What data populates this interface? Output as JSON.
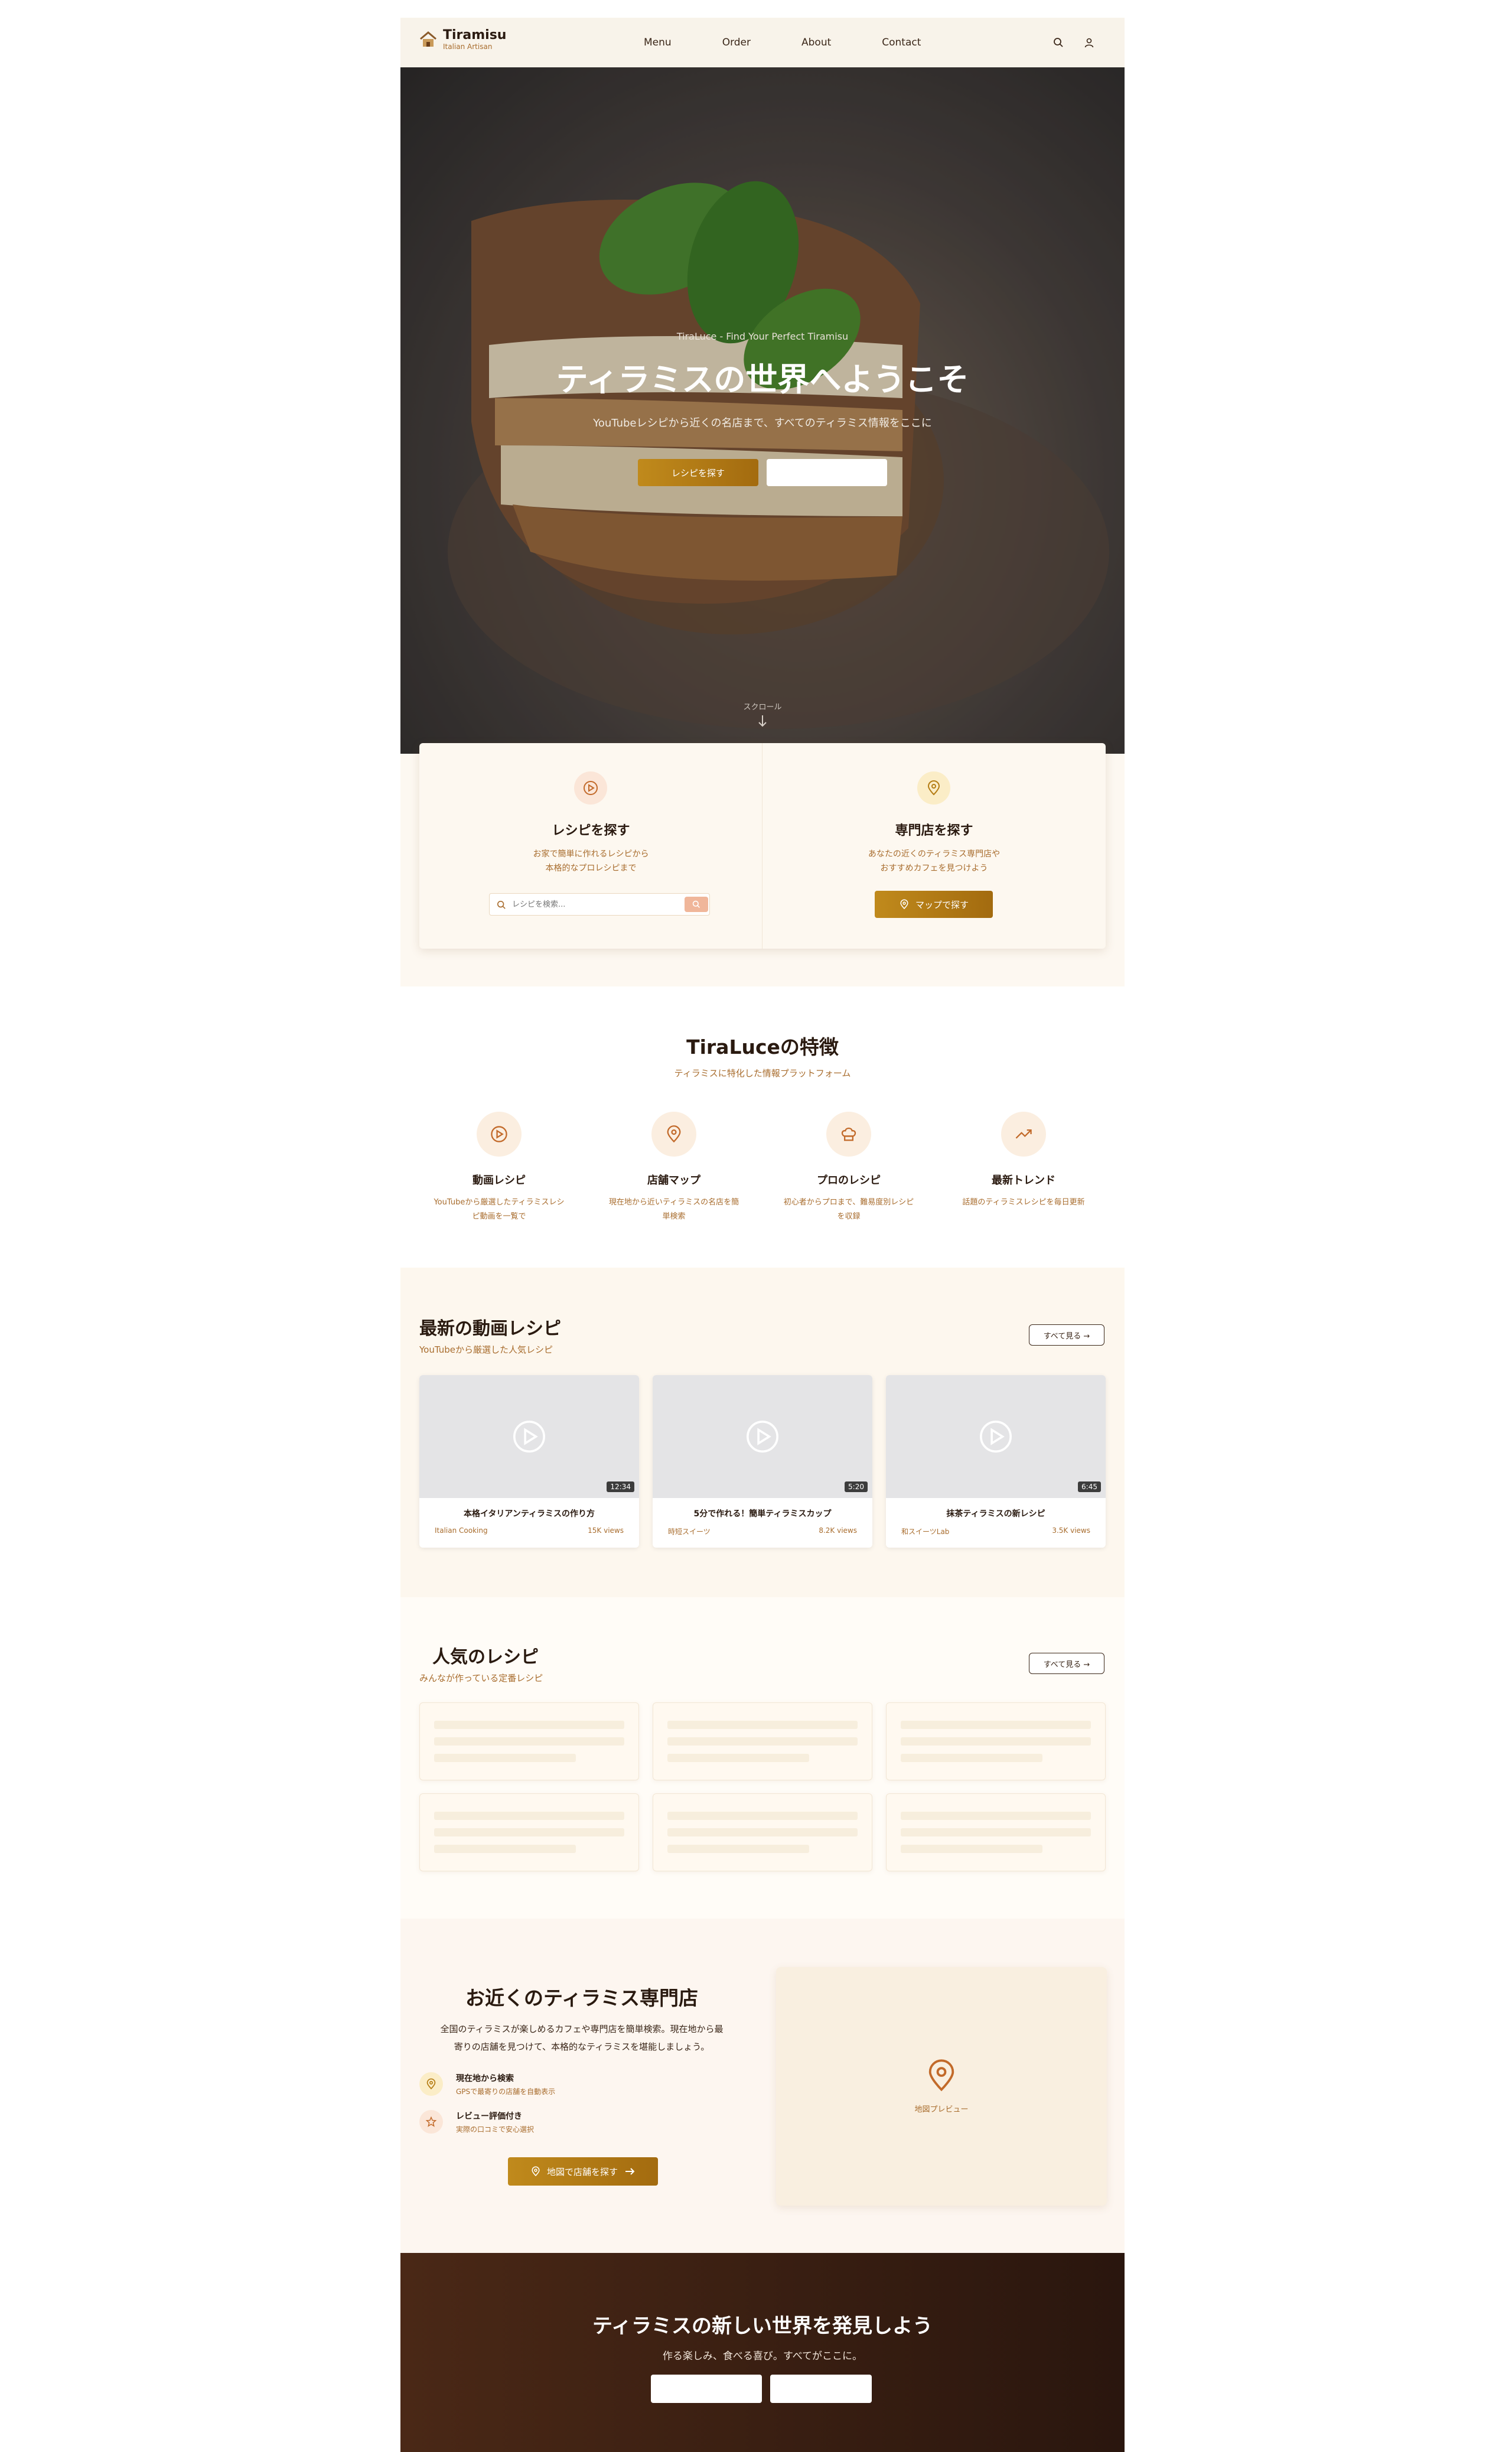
{
  "nav": {
    "logo_title": "Tiramisu",
    "logo_sub": "Italian Artisan",
    "links": [
      "Menu",
      "Order",
      "About",
      "Contact"
    ]
  },
  "hero": {
    "eyebrow": "TiraLuce - Find Your Perfect Tiramisu",
    "title": "ティラミスの世界へようこそ",
    "desc": "YouTubeレシピから近くの名店まで、すべてのティラミス情報をここに",
    "btn_primary": "レシピを探す",
    "btn_secondary": "",
    "scroll": "スクロール"
  },
  "search_card": {
    "recipe": {
      "title": "レシピを探す",
      "desc1": "お家で簡単に作れるレシピから",
      "desc2": "本格的なプロレシピまで",
      "placeholder": "レシピを検索..."
    },
    "shop": {
      "title": "専門店を探す",
      "desc1": "あなたの近くのティラミス専門店や",
      "desc2": "おすすめカフェを見つけよう",
      "button": "マップで探す"
    }
  },
  "features": {
    "title": "TiraLuceの特徴",
    "subtitle": "ティラミスに特化した情報プラットフォーム",
    "items": [
      {
        "title": "動画レシピ",
        "desc1": "YouTubeから厳選したティラミスレシ",
        "desc2": "ピ動画を一覧で",
        "icon": "play-icon"
      },
      {
        "title": "店舗マップ",
        "desc1": "現在地から近いティラミスの名店を簡",
        "desc2": "単検索",
        "icon": "map-pin-icon"
      },
      {
        "title": "プロのレシピ",
        "desc1": "初心者からプロまで、難易度別レシピ",
        "desc2": "を収録",
        "icon": "chef-hat-icon"
      },
      {
        "title": "最新トレンド",
        "desc1": "話題のティラミスレシピを毎日更新",
        "desc2": "",
        "icon": "trending-icon"
      }
    ]
  },
  "videos": {
    "title": "最新の動画レシピ",
    "subtitle": "YouTubeから厳選した人気レシピ",
    "see_all": "すべて見る →",
    "items": [
      {
        "title": "本格イタリアンティラミスの作り方",
        "channel": "Italian Cooking",
        "views": "15K views",
        "duration": "12:34"
      },
      {
        "title": "5分で作れる！簡単ティラミスカップ",
        "channel": "時短スイーツ",
        "views": "8.2K views",
        "duration": "5:20"
      },
      {
        "title": "抹茶ティラミスの新レシピ",
        "channel": "和スイーツLab",
        "views": "3.5K views",
        "duration": "6:45"
      }
    ]
  },
  "popular": {
    "title": "人気のレシピ",
    "subtitle": "みんなが作っている定番レシピ",
    "see_all": "すべて見る →"
  },
  "shops": {
    "title": "お近くのティラミス専門店",
    "desc1": "全国のティラミスが楽しめるカフェや専門店を簡単検索。現在地から最",
    "desc2": "寄りの店舗を見つけて、本格的なティラミスを堪能しましょう。",
    "feature1_title": "現在地から検索",
    "feature1_desc": "GPSで最寄りの店舗を自動表示",
    "feature2_title": "レビュー評価付き",
    "feature2_desc": "実際の口コミで安心選択",
    "button": "地図で店舗を探す",
    "map_label": "地図プレビュー"
  },
  "cta": {
    "title": "ティラミスの新しい世界を発見しよう",
    "desc": "作る楽しみ、食べる喜び。すべてがここに。",
    "btn1": "",
    "btn2": ""
  },
  "colors": {
    "accent": "#b57d14",
    "brown": "#3a2618",
    "bg_cream": "#fdf8f1",
    "cta_dark": "#3a1e12"
  }
}
